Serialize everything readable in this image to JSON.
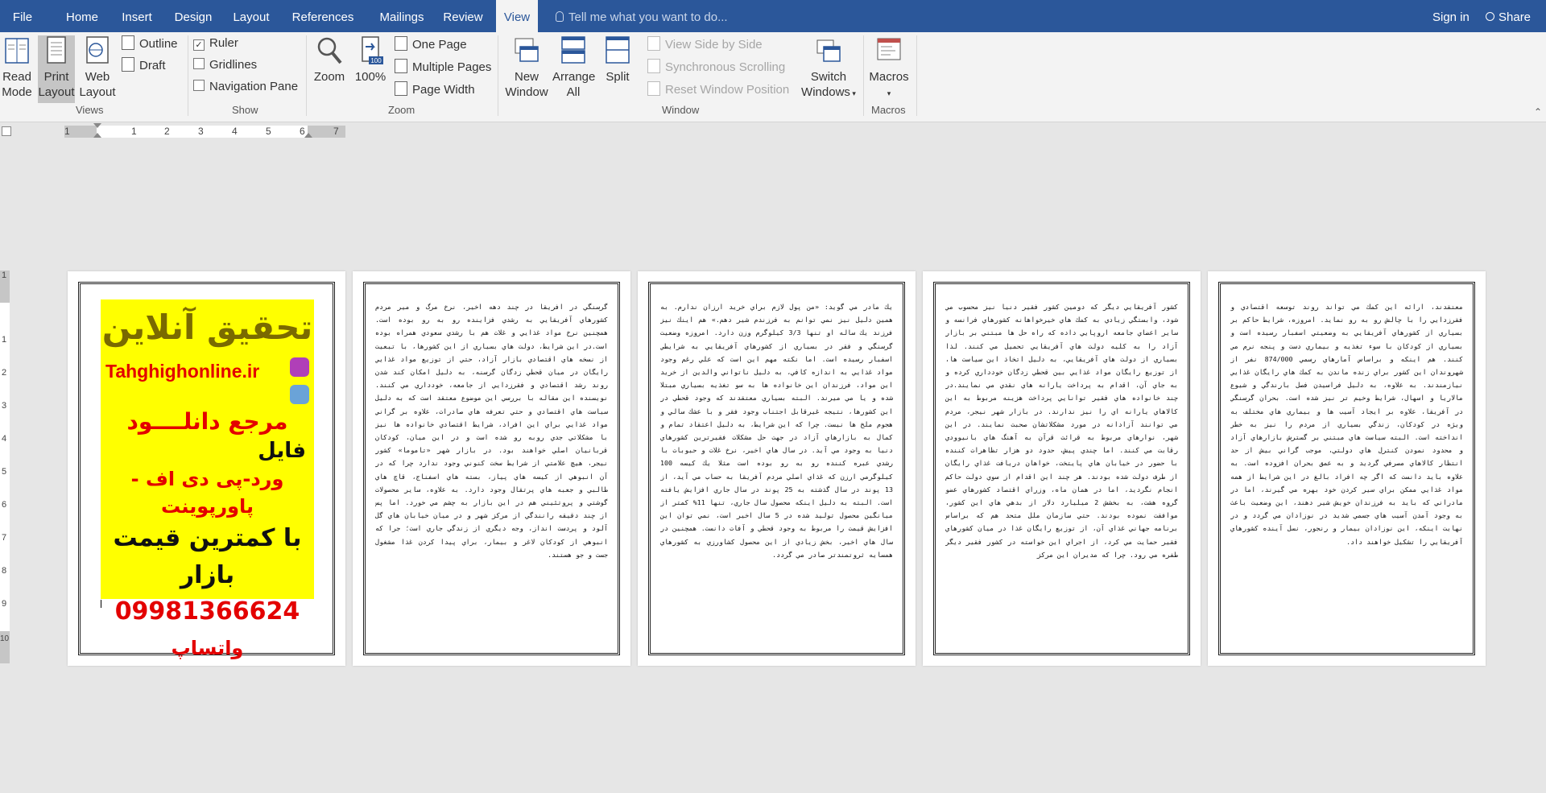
{
  "tabs": {
    "file": "File",
    "home": "Home",
    "insert": "Insert",
    "design": "Design",
    "layout": "Layout",
    "references": "References",
    "mailings": "Mailings",
    "review": "Review",
    "view": "View"
  },
  "tell_me": "Tell me what you want to do...",
  "sign_in": "Sign in",
  "share": "Share",
  "ribbon": {
    "views": {
      "label": "Views",
      "read_mode": [
        "Read",
        "Mode"
      ],
      "print_layout": [
        "Print",
        "Layout"
      ],
      "web_layout": [
        "Web",
        "Layout"
      ],
      "outline": "Outline",
      "draft": "Draft"
    },
    "show": {
      "label": "Show",
      "ruler": "Ruler",
      "gridlines": "Gridlines",
      "nav_pane": "Navigation Pane"
    },
    "zoom": {
      "label": "Zoom",
      "zoom": "Zoom",
      "hundred": "100%",
      "one_page": "One Page",
      "multiple_pages": "Multiple Pages",
      "page_width": "Page Width"
    },
    "window": {
      "label": "Window",
      "new_window": [
        "New",
        "Window"
      ],
      "arrange_all": [
        "Arrange",
        "All"
      ],
      "split": "Split",
      "side_by_side": "View Side by Side",
      "sync_scroll": "Synchronous Scrolling",
      "reset_pos": "Reset Window Position",
      "switch_windows": [
        "Switch",
        "Windows"
      ]
    },
    "macros": {
      "label": "Macros",
      "macros": "Macros"
    }
  },
  "ruler_numbers": [
    "1",
    "1",
    "2",
    "3",
    "4",
    "5",
    "6",
    "7"
  ],
  "vruler_numbers": [
    "1",
    "1",
    "2",
    "3",
    "4",
    "5",
    "6",
    "7",
    "8",
    "9",
    "10"
  ],
  "ad": {
    "title": "تحقیق آنلاین",
    "site": "Tahghighonline.ir",
    "ref": "مرجع دانلــــود",
    "file": "فایل",
    "types": "ورد-پی دی اف - پاورپوینت",
    "price": "با کمترین قیمت بازار",
    "phone": "09981366624",
    "whatsapp": "واتساپ"
  },
  "pages": [
    "گرسنگي در افريقا در چند دهه اخير، نرخ مرگ و مير مردم كشورهاي آفريقايي به رشدي فزاينده رو به رو بوده است. همچنين نرخ مواد غذايي و غلات هم با رشدي سعودي همراه بوده است.در اين شرايط، دولت هاي بسياري از اين كشورها، با تبعيت از نسخه هاي اقتصادي بازار آزاد، حتي از توزيع مواد غذايي رايگان در ميان قحطي زدگان گرسنه، به دليل امكان كند شدن روند رشد اقتصادي و فقرزدايي از جامعه، خودداري مي كنند. نويسنده اين مقاله با بررسي اين موضوع معتقد است كه به دليل سياست هاي اقتصادي و حتي تعرفه هاي صادرات، علاوه بر گراني مواد غذايي براي اين افراد، شرايط اقتصادي خانواده ها نيز با مشكلاتي جدي روبه رو شده است و در اين ميان، كودكان قربانيان اصلي خواهند بود. در بازار شهر «تاموما» كشور نيجر، هيچ علامتي از شرايط سخت كنوني وجود ندارد چرا كه در آن انبوهي از كيسه هاي پياز، بسته هاي اسفناج، قاچ هاي طالبي و جعبه هاي پرتقال وجود دارد. به علاوه، ساير محصولات گوشتي و پروتئيني هم در اين بازار به چشم مي خورد. اما پس از چند دقيقه رانندگي از مركز شهر و در ميان خيابان هاي گل آلود و پردست انداز، وجه ديگري از زندگي جاري است؛ جرا كه انبوهي از كودكان لاغر و بيمار، براي پيدا كردن غذا مشغول جست و جو هستند.",
    "يك مادر مي گويد: «من پول لازم براي خريد ارزان ندارم. به همين دليل نيز نمي توانم به فرزندم شير دهم.» هم اينك نيز فرزند يك ساله او تنها 3/3 كيلوگرم وزن دارد. امروزه وضعيت گرسنگي و فقر در بسياري از كشورهاي آفريقايي به شرايطي اسفبار رسيده است. اما نكته مهم اين است كه علي رغم وجود مواد غذايي به اندازه كافي، به دليل ناتواني والدين از خريد اين مواد، فرزندان اين خانواده ها به سو تغذيه بسياري مبتلا شده و يا مي ميرند. البته بسياري معتقدند كه وجود قحطي در اين كشورها، نتيجه غيرقابل اجتناب وجود فقر و با عشك سالي و هجوم ملخ ها نيست. چرا كه اين شرايط، به دليل اعتقاد تمام و كمال به بازارهاي آزاد در جهت حل مشكلات فقيرترين كشورهاي دنيا به وجود مي آيد. در سال هاي اخير، نرخ غلات و حبوبات با رشدي عبره كننده رو به رو بوده است مثلا يك كيسه 100 كيلوگرمي ارزن كه غذاي اصلي مردم آفريقا به حساب مي آيد، از 13 پوند در سال گذشته به 25 پوند در سال جاري افزايش يافته است. البته به دليل اينكه محصول سال جاري، تنها 11% كمتر از ميانگين محصول توليد شده در 5 سال اخير است، نمي توان اين افزايش قيمت را مربوط به وجود قحطي و آفات دانست. همچنين در سال هاي اخير، بخش زيادي از اين محصول كشاورزي به كشورهاي همسايه ثروتمندتر صادر مي گردد.",
    "كشور آفريقايي ديگر كه دومين كشور فقير دنيا نيز محسوب مي شود، وابستگي زيادي به كمك هاي خيرخواهانه كشورهاي فرانسه و ساير اعضاي جامعه اروپايي داده كه راه حل ها مبتني بر بازار آزاد را به كليه دولت هاي آفريقايي تحميل مي كنند. لذا بسياري از دولت هاي آفريقايي، به دليل اتخاذ اين سياست ها، از توزيع رايگان مواد غذايي بين قحطي زدگان خودداري كرده و به جاي آن، اقدام به پرداخت يارانه هاي نقدي مي نمايند.در چند خانواده هاي فقير توانايي پرداخت هزينه مربوط به اين كالاهاي يارانه اي را نيز ندارند. در بازار شهر نيجر، مردم مي توانند آزادانه در مورد مشكلاتشان صحبت نمايند. در اين شهر، نوارهاي مربوط به قرائت قرآن به آهنگ هاي بانيوودي رقابت مي كنند. اما چندي پيش، حدود دو هزار تظاهرات كننده با حضور در خيابان هاي پايتخت، خواهان دريافت غذاي رايگان از طرف دولت شده بودند. هر چند اين اقدام از سوي دولت حاكم انجام نگرديد، اما در همان ماه، وزراي اقتصاد كشورهاي عضو گروه هشت، به بخشش 2 ميليارد دلار از بدهي هاي اين كشور، موافقت نموده بودند. حتي سازمان ملل متحد هم كه براساس برنامه جهاني غذاي آن، از توزيع رايگان غذا در ميان كشورهاي فقير حمايت مي كرد، از اجراي اين خواسته در كشور فقير ديگر طفره مي رود. چرا كه مديران اين مركز",
    "معتقدند، ارائه اين كمك مي تواند روند توسعه اقتصادي و فقرزدايي را با چالش رو به رو نمايد. امروزه، شرايط حاكم بر بسياري از كشورهاي آفريقايي به وضعيتي اسفبار رسيده است و بسياري از كودكان با سوء تغذيه و بيماري دست و پنجه نرم مي كنند. هم اينكه و براساس آمارهاي رسمي 874/000 نفر از شهروندان اين كشور براي زنده ماندن به كمك هاي رايگان غذايي نيازمندند. به علاوه، به دليل فراسيدن فصل بارندگي و شيوع مالاريا و اسهال، شرايط وخيم تر نيز شده است. بحران گرسنگي در آفريقا، علاوه بر ايجاد آسيب ها و بيماري هاي مختلف به ويژه در كودكان، زندگي بسياري از مردم را نيز به خطر انداخته است. البته سياست هاي مبتني بر گسترش بازارهاي آزاد و محدود نمودن كنترل هاي دولتي، موجب گراني بيش از حد انتظار كالاهاي مصرفي گرديد و به عمق بحران افزوده است. به علاوه بايد دانست كه اگر چه افراد بالغ در اين شرايط از همه مواد غذايي ممكن براي سير كردن خود بهره مي گيرند، اما در مادراني كه بايد به فرزندان خويش شير دهند، اين وضعيت باعث به وجود آمدن آسيب هاي جسمي شديد در نوزادان مي گردد و در نهايت اينكه، اين نوزادان بيمار و رنجور، نسل آينده كشورهاي آفريقايي را تشكيل خواهند داد."
  ]
}
